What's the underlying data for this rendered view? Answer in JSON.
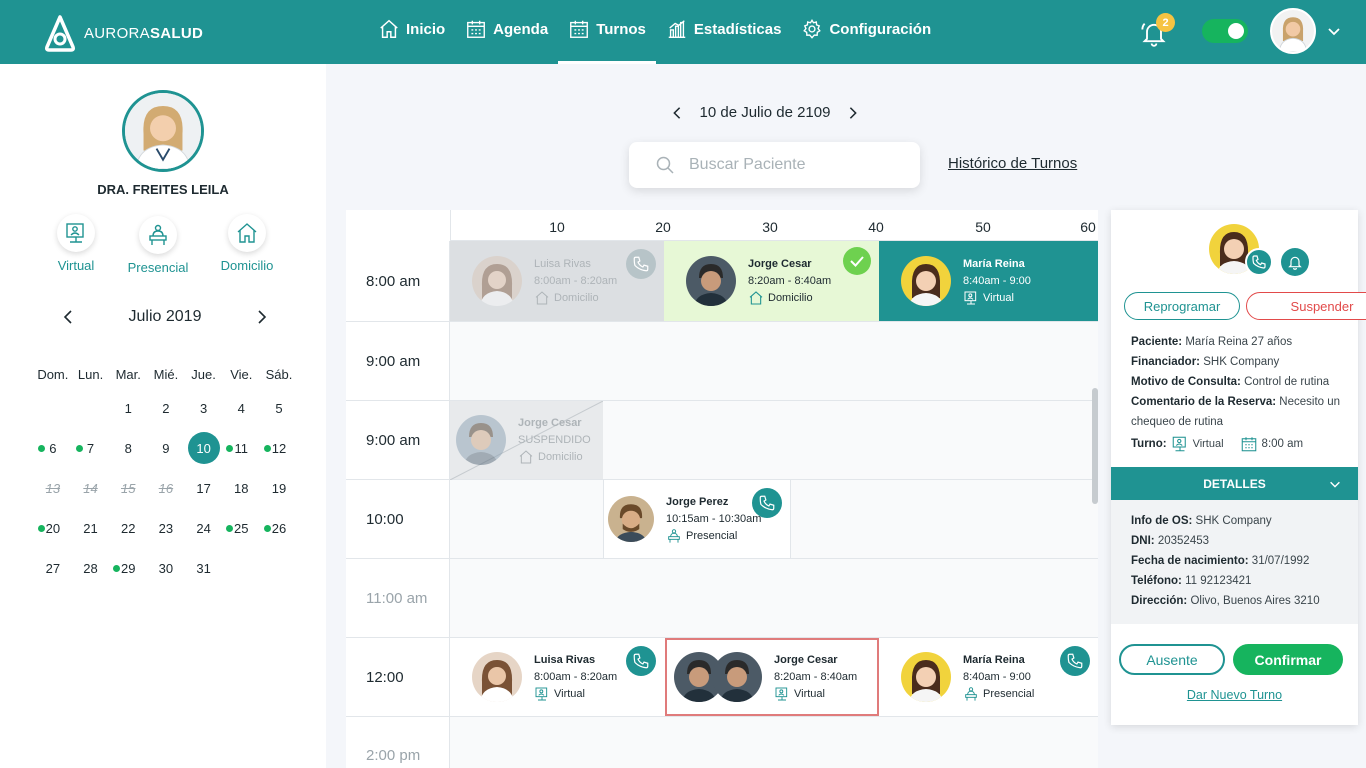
{
  "colors": {
    "brand": "#1f9392",
    "success": "#16b45e",
    "danger": "#e24a4a",
    "badge": "#f6c342"
  },
  "brand": {
    "part1": "AURORA",
    "part2": "SALUD"
  },
  "nav": [
    {
      "label": "Inicio",
      "icon": "home-icon"
    },
    {
      "label": "Agenda",
      "icon": "calendar-icon"
    },
    {
      "label": "Turnos",
      "icon": "calendar-icon",
      "active": true
    },
    {
      "label": "Estadísticas",
      "icon": "stats-icon"
    },
    {
      "label": "Configuración",
      "icon": "gear-icon"
    }
  ],
  "notifications": {
    "count": "2"
  },
  "doctor": {
    "name": "DRA. FREITES LEILA"
  },
  "modes": [
    {
      "label": "Virtual",
      "icon": "virtual-icon"
    },
    {
      "label": "Presencial",
      "icon": "presencial-icon"
    },
    {
      "label": "Domicilio",
      "icon": "home-icon"
    }
  ],
  "calendar": {
    "month_label": "Julio 2019",
    "weekdays": [
      "Dom.",
      "Lun.",
      "Mar.",
      "Mié.",
      "Jue.",
      "Vie.",
      "Sáb."
    ],
    "weeks": [
      [
        {
          "d": ""
        },
        {
          "d": ""
        },
        {
          "d": "1"
        },
        {
          "d": "2"
        },
        {
          "d": "3"
        },
        {
          "d": "4"
        },
        {
          "d": "5"
        }
      ],
      [
        {
          "d": "6",
          "dot": true
        },
        {
          "d": "7",
          "dot": true
        },
        {
          "d": "8"
        },
        {
          "d": "9"
        },
        {
          "d": "10",
          "selected": true
        },
        {
          "d": "11",
          "dot": true
        },
        {
          "d": "12",
          "dot": true
        }
      ],
      [
        {
          "d": "13",
          "crossed": true
        },
        {
          "d": "14",
          "crossed": true
        },
        {
          "d": "15",
          "crossed": true
        },
        {
          "d": "16",
          "crossed": true
        },
        {
          "d": "17"
        },
        {
          "d": "18"
        },
        {
          "d": "19"
        }
      ],
      [
        {
          "d": "20",
          "dot": true
        },
        {
          "d": "21"
        },
        {
          "d": "22"
        },
        {
          "d": "23"
        },
        {
          "d": "24"
        },
        {
          "d": "25",
          "dot": true
        },
        {
          "d": "26",
          "dot": true
        }
      ],
      [
        {
          "d": "27"
        },
        {
          "d": "28"
        },
        {
          "d": "29",
          "dot": true
        },
        {
          "d": "30"
        },
        {
          "d": "31"
        },
        {
          "d": ""
        },
        {
          "d": ""
        }
      ]
    ]
  },
  "day": {
    "label": "10 de Julio de 2109"
  },
  "search": {
    "placeholder": "Buscar Paciente"
  },
  "history_link": "Histórico de Turnos",
  "minutes": [
    "10",
    "20",
    "30",
    "40",
    "50",
    "60"
  ],
  "rows": {
    "r1": {
      "time": "8:00 am"
    },
    "r2": {
      "time": "9:00 am"
    },
    "r3": {
      "time": "9:00 am"
    },
    "r4": {
      "time": "10:00"
    },
    "r5": {
      "time": "11:00 am"
    },
    "r6": {
      "time": "12:00"
    },
    "r7": {
      "time": "2:00 pm"
    }
  },
  "appts": {
    "a1": {
      "name": "Luisa Rivas",
      "time": "8:00am - 8:20am",
      "type": "Domicilio"
    },
    "a2": {
      "name": "Jorge Cesar",
      "time": "8:20am - 8:40am",
      "type": "Domicilio"
    },
    "a3": {
      "name": "María Reina",
      "time": "8:40am - 9:00",
      "type": "Virtual"
    },
    "a4": {
      "name": "Jorge Cesar",
      "status": "SUSPENDIDO",
      "type": "Domicilio"
    },
    "a5": {
      "name": "Jorge Perez",
      "time": "10:15am - 10:30am",
      "type": "Presencial"
    },
    "a6": {
      "name": "Luisa Rivas",
      "time": "8:00am - 8:20am",
      "type": "Virtual"
    },
    "a7": {
      "name": "Jorge Cesar",
      "time": "8:20am - 8:40am",
      "type": "Virtual"
    },
    "a8": {
      "name": "María Reina",
      "time": "8:40am - 9:00",
      "type": "Presencial"
    }
  },
  "detail": {
    "reprogram": "Reprogramar",
    "suspend": "Suspender",
    "patient_label": "Paciente:",
    "patient_value": "María Reina 27 años",
    "financer_label": "Financiador:",
    "financer_value": "SHK Company",
    "reason_label": "Motivo de Consulta:",
    "reason_value": "Control de rutina",
    "comment_label": "Comentario de la Reserva:",
    "comment_value": "Necesito un chequeo de rutina",
    "turno_label": "Turno:",
    "turno_type": "Virtual",
    "turno_time": "8:00 am",
    "details_header": "DETALLES",
    "os_label": "Info de OS:",
    "os_value": "SHK Company",
    "dni_label": "DNI:",
    "dni_value": "20352453",
    "birth_label": "Fecha de nacimiento:",
    "birth_value": "31/07/1992",
    "phone_label": "Teléfono:",
    "phone_value": "11 92123421",
    "address_label": "Dirección:",
    "address_value": "Olivo, Buenos Aires 3210",
    "absent": "Ausente",
    "confirm": "Confirmar",
    "new_turn": "Dar Nuevo Turno"
  }
}
